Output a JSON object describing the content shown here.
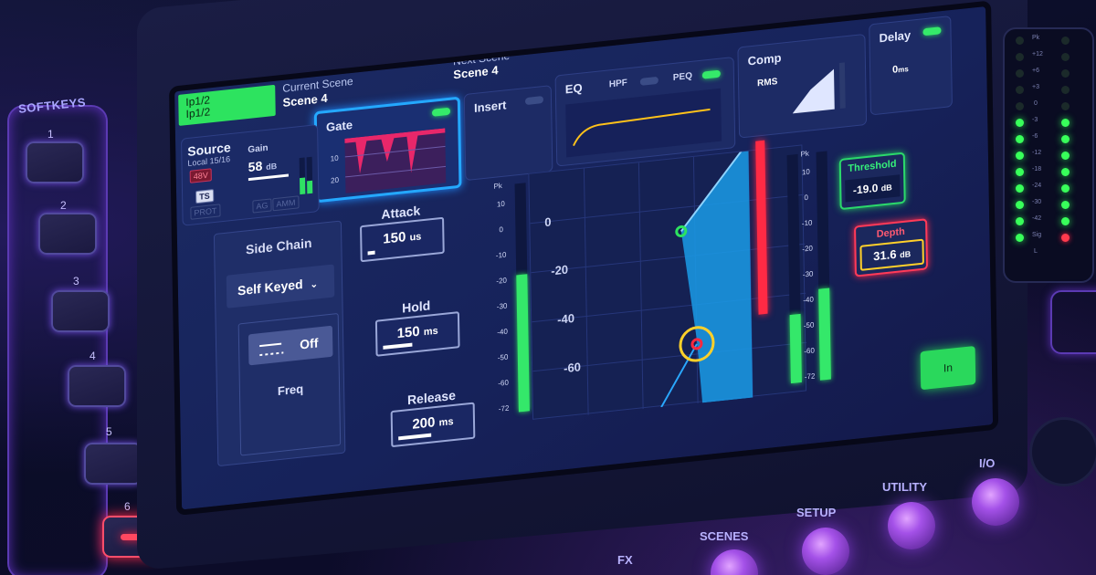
{
  "softkeys": {
    "title": "SOFTKEYS",
    "keys": [
      {
        "number": "1"
      },
      {
        "number": "2"
      },
      {
        "number": "3"
      },
      {
        "number": "4"
      },
      {
        "number": "5"
      },
      {
        "number": "6"
      }
    ]
  },
  "hardware_buttons": {
    "fx": "FX",
    "scenes": "SCENES",
    "setup": "SETUP",
    "utility": "UTILITY",
    "io": "I/O"
  },
  "colors": {
    "accent_green": "#2de35f",
    "accent_blue": "#24a8ff",
    "accent_red": "#ff3a58",
    "accent_yellow": "#ffd02a"
  },
  "header": {
    "channel_chip_line1": "Ip1/2",
    "channel_chip_line2": "Ip1/2",
    "current_scene_label": "Current Scene",
    "current_scene_value": "Scene 4",
    "next_scene_label": "Next Scene",
    "next_scene_value": "Scene 4"
  },
  "tabs": {
    "gate": {
      "label": "Gate",
      "enabled": true,
      "scale": [
        "10",
        "20"
      ]
    },
    "insert": {
      "label": "Insert",
      "enabled": false
    },
    "eq": {
      "label": "EQ",
      "hpf_label": "HPF",
      "peq_label": "PEQ",
      "peq_enabled": true
    },
    "comp": {
      "label": "Comp",
      "mode": "RMS"
    },
    "delay": {
      "label": "Delay",
      "value": "0",
      "unit": "ms",
      "enabled": true
    }
  },
  "source": {
    "label": "Source",
    "sublabel": "Local 15/16",
    "phantom": "48V",
    "ts_badge": "TS",
    "prot_badge": "PROT",
    "gain_label": "Gain",
    "gain_value": "58",
    "gain_unit": "dB",
    "ag_badge": "AG",
    "amm_badge": "AMM"
  },
  "side_chain": {
    "title": "Side Chain",
    "source": "Self Keyed",
    "filter_state": "Off",
    "freq_label": "Freq"
  },
  "parameters": [
    {
      "id": "attack",
      "label": "Attack",
      "value": "150",
      "unit": "us",
      "level": 0.1
    },
    {
      "id": "hold",
      "label": "Hold",
      "value": "150",
      "unit": "ms",
      "level": 0.4
    },
    {
      "id": "release",
      "label": "Release",
      "value": "200",
      "unit": "ms",
      "level": 0.45
    }
  ],
  "graph": {
    "axis_labels": [
      "0",
      "-20",
      "-40",
      "-60"
    ],
    "in_meter_scale": [
      "Pk",
      "10",
      "0",
      "-10",
      "-20",
      "-30",
      "-40",
      "-50",
      "-60",
      "-72"
    ],
    "in_meter_level": 0.6,
    "gain_reduction_level": 0.8
  },
  "out_meter": {
    "scale": [
      "Pk",
      "10",
      "0",
      "-10",
      "-20",
      "-30",
      "-40",
      "-50",
      "-60",
      "-72"
    ],
    "left_level": 0.3,
    "right_level": 0.4
  },
  "threshold": {
    "label": "Threshold",
    "value": "-19.0",
    "unit": "dB"
  },
  "depth": {
    "label": "Depth",
    "value": "31.6",
    "unit": "dB"
  },
  "in_button": {
    "label": "In"
  },
  "hardware_meter": {
    "scale": [
      "Pk",
      "+12",
      "+6",
      "+3",
      "0",
      "-3",
      "-6",
      "-12",
      "-18",
      "-24",
      "-30",
      "-42",
      "Sig",
      "L"
    ]
  }
}
